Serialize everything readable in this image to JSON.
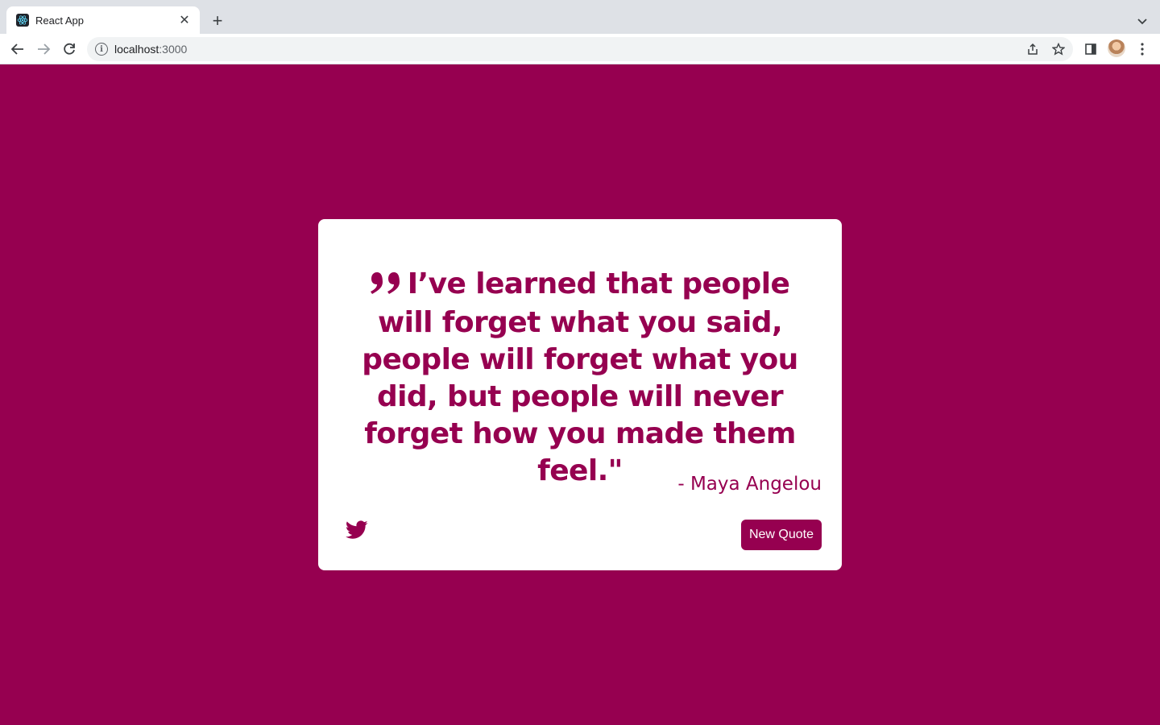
{
  "browser": {
    "tab_title": "React App",
    "url_host": "localhost",
    "url_port": ":3000",
    "icons": [
      "react-favicon",
      "close-icon",
      "plus-icon",
      "chevron-down-icon",
      "back-arrow-icon",
      "forward-arrow-icon",
      "reload-icon",
      "info-icon",
      "share-icon",
      "star-icon",
      "side-panel-icon",
      "profile-avatar",
      "kebab-menu-icon"
    ]
  },
  "quote": {
    "text": "I’ve learned that people will forget what you said, people will forget what you did, but people will never forget how you made them feel.\"",
    "author": "- Maya Angelou",
    "new_quote_label": "New Quote",
    "icons": [
      "quote-left-icon",
      "twitter-icon"
    ]
  },
  "colors": {
    "accent": "#960050",
    "card": "#ffffff",
    "chrome_tabstrip": "#dee1e6"
  }
}
